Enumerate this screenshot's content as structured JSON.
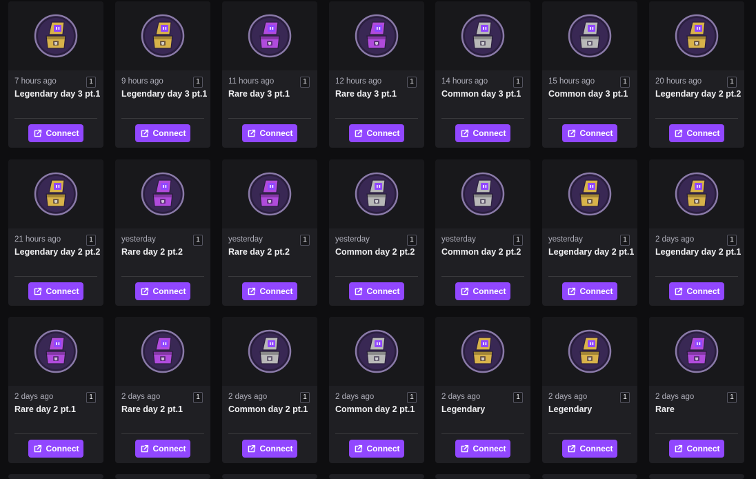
{
  "colors": {
    "accent": "#9147ff",
    "legendary": "#d8b24a",
    "rare": "#b04bdc",
    "common": "#b8b8b8"
  },
  "icons": {
    "card_image": "twitch-crate-icon",
    "button": "external-link-icon"
  },
  "cards": [
    {
      "time": "7 hours ago",
      "qty": "1",
      "title": "Legendary day 3 pt.1",
      "tier": "legendary",
      "button": "Connect"
    },
    {
      "time": "9 hours ago",
      "qty": "1",
      "title": "Legendary day 3 pt.1",
      "tier": "legendary",
      "button": "Connect"
    },
    {
      "time": "11 hours ago",
      "qty": "1",
      "title": "Rare day 3 pt.1",
      "tier": "rare",
      "button": "Connect"
    },
    {
      "time": "12 hours ago",
      "qty": "1",
      "title": "Rare day 3 pt.1",
      "tier": "rare",
      "button": "Connect"
    },
    {
      "time": "14 hours ago",
      "qty": "1",
      "title": "Common day 3 pt.1",
      "tier": "common",
      "button": "Connect"
    },
    {
      "time": "15 hours ago",
      "qty": "1",
      "title": "Common day 3 pt.1",
      "tier": "common",
      "button": "Connect"
    },
    {
      "time": "20 hours ago",
      "qty": "1",
      "title": "Legendary day 2 pt.2",
      "tier": "legendary",
      "button": "Connect"
    },
    {
      "time": "21 hours ago",
      "qty": "1",
      "title": "Legendary day 2 pt.2",
      "tier": "legendary",
      "button": "Connect"
    },
    {
      "time": "yesterday",
      "qty": "1",
      "title": "Rare day 2 pt.2",
      "tier": "rare",
      "button": "Connect"
    },
    {
      "time": "yesterday",
      "qty": "1",
      "title": "Rare day 2 pt.2",
      "tier": "rare",
      "button": "Connect"
    },
    {
      "time": "yesterday",
      "qty": "1",
      "title": "Common day 2 pt.2",
      "tier": "common",
      "button": "Connect"
    },
    {
      "time": "yesterday",
      "qty": "1",
      "title": "Common day 2 pt.2",
      "tier": "common",
      "button": "Connect"
    },
    {
      "time": "yesterday",
      "qty": "1",
      "title": "Legendary day 2 pt.1",
      "tier": "legendary",
      "button": "Connect"
    },
    {
      "time": "2 days ago",
      "qty": "1",
      "title": "Legendary day 2 pt.1",
      "tier": "legendary",
      "button": "Connect"
    },
    {
      "time": "2 days ago",
      "qty": "1",
      "title": "Rare day 2 pt.1",
      "tier": "rare",
      "button": "Connect"
    },
    {
      "time": "2 days ago",
      "qty": "1",
      "title": "Rare day 2 pt.1",
      "tier": "rare",
      "button": "Connect"
    },
    {
      "time": "2 days ago",
      "qty": "1",
      "title": "Common day 2 pt.1",
      "tier": "common",
      "button": "Connect"
    },
    {
      "time": "2 days ago",
      "qty": "1",
      "title": "Common day 2 pt.1",
      "tier": "common",
      "button": "Connect"
    },
    {
      "time": "2 days ago",
      "qty": "1",
      "title": "Legendary",
      "tier": "legendary",
      "button": "Connect"
    },
    {
      "time": "2 days ago",
      "qty": "1",
      "title": "Legendary",
      "tier": "legendary",
      "button": "Connect"
    },
    {
      "time": "2 days ago",
      "qty": "1",
      "title": "Rare",
      "tier": "rare",
      "button": "Connect"
    }
  ]
}
